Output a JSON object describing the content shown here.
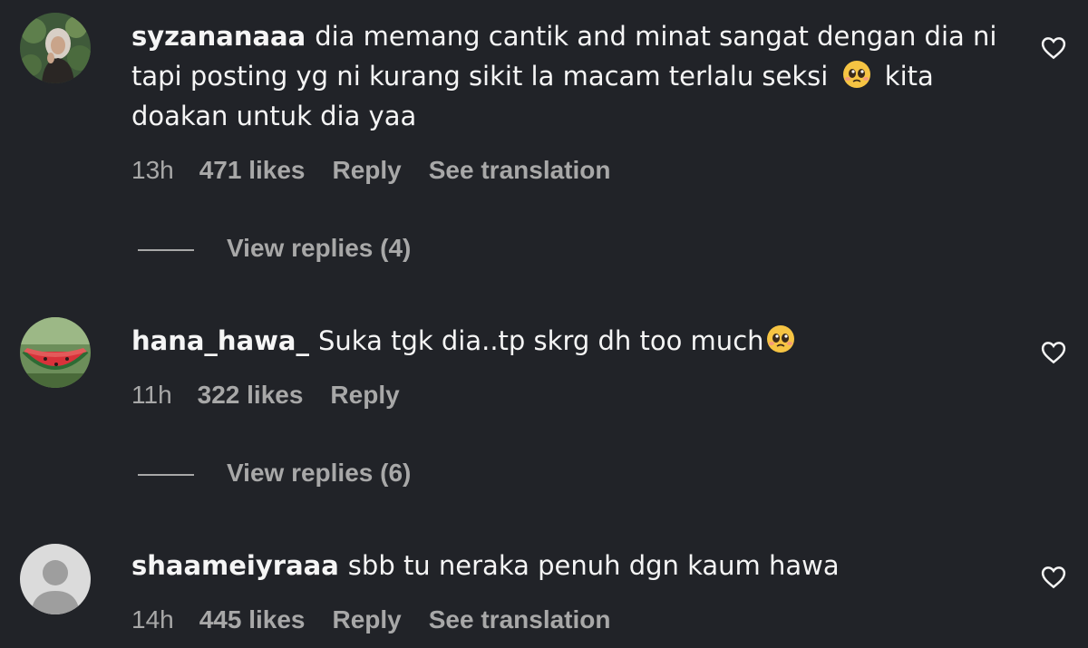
{
  "comments": [
    {
      "username": "syzananaaa",
      "text_part1": "dia memang cantik and minat sangat dengan dia ni tapi posting yg ni kurang sikit la macam terlalu seksi",
      "emoji": "pleading-face",
      "text_part2": "kita doakan untuk dia yaa",
      "time": "13h",
      "likes": "471 likes",
      "reply": "Reply",
      "translate": "See translation",
      "view_replies": "View replies (4)",
      "avatar": "profile-photo-icon",
      "like_icon": "heart-outline-icon"
    },
    {
      "username": "hana_hawa_",
      "text_part1": "Suka tgk dia..tp skrg dh too much",
      "emoji": "pleading-face",
      "time": "11h",
      "likes": "322 likes",
      "reply": "Reply",
      "view_replies": "View replies (6)",
      "avatar": "watermelon-photo-icon",
      "like_icon": "heart-outline-icon"
    },
    {
      "username": "shaameiyraaa",
      "text_part1": "sbb tu neraka penuh dgn kaum hawa",
      "time": "14h",
      "likes": "445 likes",
      "reply": "Reply",
      "translate": "See translation",
      "avatar": "default-user-icon",
      "like_icon": "heart-outline-icon"
    }
  ],
  "colors": {
    "background": "#212328",
    "text": "#f5f5f5",
    "secondary": "#a8a8a8"
  }
}
